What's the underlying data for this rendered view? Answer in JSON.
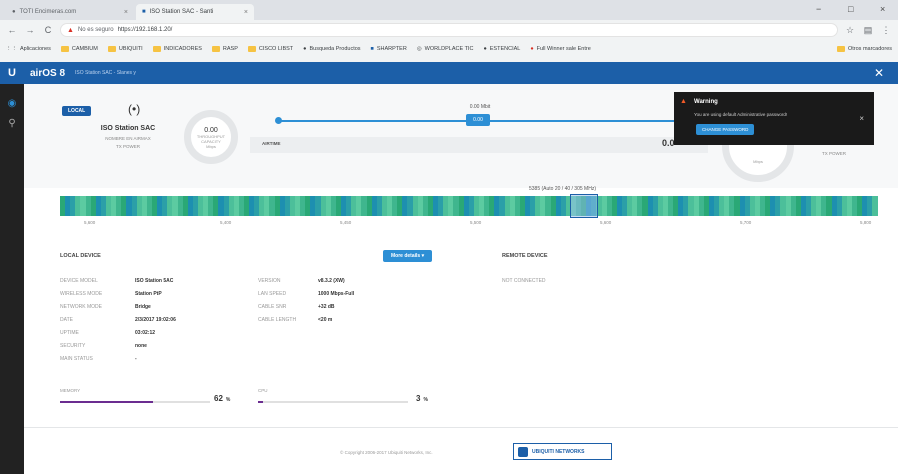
{
  "browser": {
    "tabs": [
      {
        "title": "TOTI Encimeras.com"
      },
      {
        "title": "ISO Station SAC - Santi"
      }
    ],
    "nav": {
      "back": "←",
      "forward": "→",
      "reload": "C"
    },
    "address": {
      "security": "No es seguro",
      "url": "https://192.168.1.20/"
    },
    "bookmarks": [
      "Aplicaciones",
      "CAMBIUM",
      "UBIQUITI",
      "INDICADORES",
      "RASP",
      "CISCO LIBST",
      "Busqueda Productos",
      "SHARPTER",
      "WORLDPLACE TIC",
      "ESTENCIAL",
      "Full Winner sale Entre"
    ],
    "bookmarks_more": "Otros marcadores",
    "window_controls": [
      "−",
      "□",
      "×"
    ]
  },
  "app": {
    "logo": "U",
    "product": "airOS 8",
    "device_header": "ISO Station SAC - Slanes y"
  },
  "overview": {
    "local_badge": "LOCAL",
    "device_name": "ISO Station SAC",
    "device_sub": "NOMBRE EN AIRMAX",
    "tx_power": "TX POWER",
    "capacity_value": "0.00",
    "capacity_label": "THROUGHPUT CAPACITY",
    "capacity_unit": "Mbps",
    "link_speed": "0.00 Mbit",
    "link_bubble": "0.00",
    "airtime_label": "AIRTIME",
    "airtime_value": "0.0",
    "remote_unit": "Mbps",
    "remote_tx_power": "TX POWER"
  },
  "warning": {
    "title": "Warning",
    "text": "You are using default Administrative password!",
    "button": "CHANGE PASSWORD"
  },
  "spectrum": {
    "caption": "5385 (Auto 20 / 40 / 305 MHz)",
    "ticks": [
      "5,600",
      "5,400",
      "5,450",
      "5,500",
      "5,600",
      "5,700",
      "5,800"
    ]
  },
  "local_device": {
    "header": "LOCAL DEVICE",
    "more_button": "More details",
    "left": [
      {
        "k": "DEVICE MODEL",
        "v": "ISO Station 5AC"
      },
      {
        "k": "WIRELESS MODE",
        "v": "Station PtP"
      },
      {
        "k": "NETWORK MODE",
        "v": "Bridge"
      },
      {
        "k": "DATE",
        "v": "2/3/2017 19:02:06"
      },
      {
        "k": "UPTIME",
        "v": "03:02:12"
      },
      {
        "k": "SECURITY",
        "v": "none"
      },
      {
        "k": "MAIN STATUS",
        "v": "-"
      }
    ],
    "right": [
      {
        "k": "VERSION",
        "v": "v8.3.2 (XW)"
      },
      {
        "k": "LAN SPEED",
        "v": "1000 Mbps-Full"
      },
      {
        "k": "CABLE SNR",
        "v": "+32 dB"
      },
      {
        "k": "CABLE LENGTH",
        "v": "<20 m"
      }
    ],
    "memory": {
      "label": "MEMORY",
      "value": "62",
      "unit": "%",
      "fraction": 0.62
    },
    "cpu": {
      "label": "CPU",
      "value": "3",
      "unit": "%",
      "fraction": 0.03
    }
  },
  "remote_device": {
    "header": "REMOTE DEVICE",
    "status": "NOT CONNECTED"
  },
  "footer": {
    "copyright": "© Copyright 2006-2017 Ubiquiti Networks, Inc.",
    "logo_text": "UBIQUITI NETWORKS"
  },
  "colors": {
    "accent": "#1c5fa8",
    "link": "#2d8fd5",
    "warning": "#f05a28",
    "memory": "#6b2d90"
  }
}
